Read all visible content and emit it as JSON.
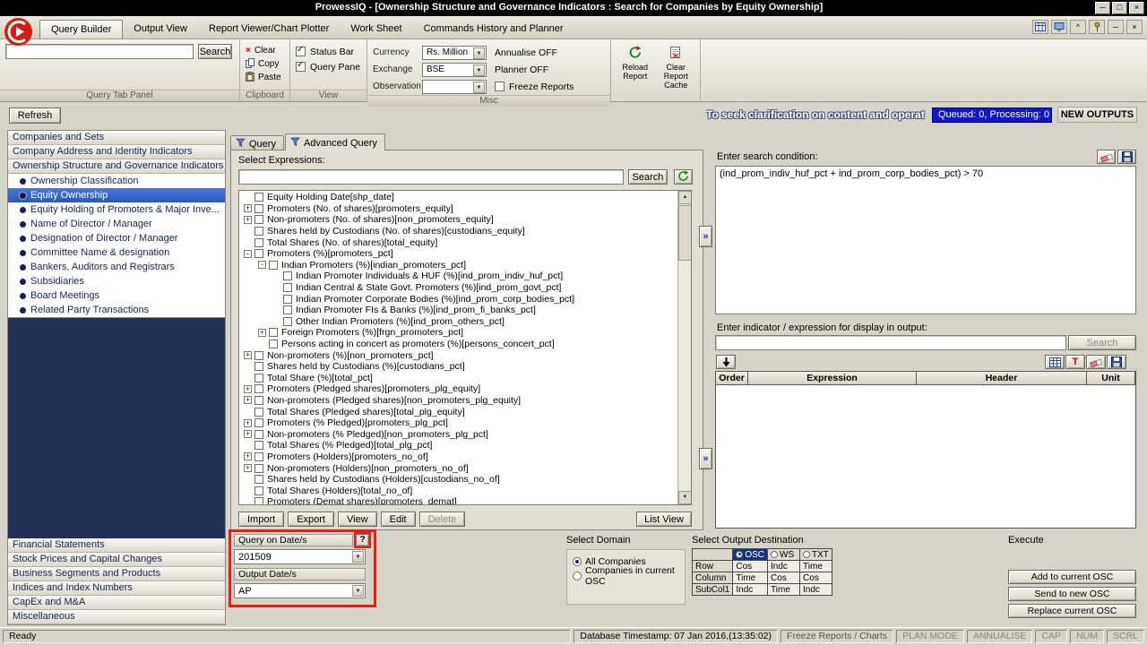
{
  "window": {
    "title": "ProwessIQ  - [Ownership Structure and Governance Indicators : Search for Companies by Equity Ownership]"
  },
  "menu": {
    "tabs": [
      {
        "label": "Query Builder",
        "active": true
      },
      {
        "label": "Output View",
        "active": false
      },
      {
        "label": "Report Viewer/Chart Plotter",
        "active": false
      },
      {
        "label": "Work Sheet",
        "active": false
      },
      {
        "label": "Commands History and Planner",
        "active": false
      }
    ]
  },
  "toolbar": {
    "search": {
      "button": "Search",
      "group_label": "Query Tab Panel"
    },
    "clipboard": {
      "buttons": [
        "Clear",
        "Copy",
        "Paste"
      ],
      "group_label": "Clipboard"
    },
    "view": {
      "checkboxes": [
        {
          "label": "Status Bar",
          "checked": true
        },
        {
          "label": "Query Pane",
          "checked": true
        }
      ],
      "group_label": "View"
    },
    "misc": {
      "fields": [
        {
          "label": "Currency",
          "value": "Rs. Million"
        },
        {
          "label": "Exchange",
          "value": "BSE"
        },
        {
          "label": "Observation",
          "value": ""
        }
      ],
      "toggles": [
        "Annualise OFF",
        "Planner OFF"
      ],
      "freeze_checkbox": {
        "label": "Freeze Reports",
        "checked": false
      },
      "group_label": "Misc"
    },
    "report_buttons": [
      "Reload Report",
      "Clear Report Cache"
    ]
  },
  "info_bar": {
    "refresh_button": "Refresh",
    "marquee": "To seek clarification on content and operat",
    "queue_status": "Queued: 0, Processing: 0",
    "new_outputs": "NEW OUTPUTS"
  },
  "sidebar": {
    "top_sections": [
      "Companies and Sets",
      "Company Address and Identity Indicators",
      "Ownership Structure and Governance Indicators"
    ],
    "items": [
      {
        "label": "Ownership Classification",
        "selected": false
      },
      {
        "label": "Equity Ownership",
        "selected": true
      },
      {
        "label": "Equity Holding of Promoters & Major Inve...",
        "selected": false
      },
      {
        "label": "Name of Director / Manager",
        "selected": false
      },
      {
        "label": "Designation of Director / Manager",
        "selected": false
      },
      {
        "label": "Committee Name & designation",
        "selected": false
      },
      {
        "label": "Bankers, Auditors and Registrars",
        "selected": false
      },
      {
        "label": "Subsidiaries",
        "selected": false
      },
      {
        "label": "Board Meetings",
        "selected": false
      },
      {
        "label": "Related Party Transactions",
        "selected": false
      }
    ],
    "bottom_sections": [
      "Financial Statements",
      "Stock Prices and Capital Changes",
      "Business Segments and Products",
      "Indices and Index Numbers",
      "CapEx and M&A",
      "Miscellaneous"
    ]
  },
  "query_panel": {
    "tabs": [
      {
        "label": "Query",
        "active": false
      },
      {
        "label": "Advanced Query",
        "active": true
      }
    ],
    "select_expressions_label": "Select Expressions:",
    "search_button": "Search",
    "tree": [
      {
        "label": "Equity Holding Date[shp_date]",
        "level": 0,
        "exp": "none"
      },
      {
        "label": "Promoters (No. of shares)[promoters_equity]",
        "level": 0,
        "exp": "plus"
      },
      {
        "label": "Non-promoters (No. of shares)[non_promoters_equity]",
        "level": 0,
        "exp": "plus"
      },
      {
        "label": "Shares held by Custodians (No. of shares)[custodians_equity]",
        "level": 0,
        "exp": "none"
      },
      {
        "label": "Total Shares (No. of shares)[total_equity]",
        "level": 0,
        "exp": "none"
      },
      {
        "label": "Promoters (%)[promoters_pct]",
        "level": 0,
        "exp": "minus"
      },
      {
        "label": "Indian Promoters (%)[indian_promoters_pct]",
        "level": 1,
        "exp": "minus"
      },
      {
        "label": "Indian Promoter Individuals & HUF (%)[ind_prom_indiv_huf_pct]",
        "level": 2,
        "exp": "none"
      },
      {
        "label": "Indian Central & State Govt. Promoters (%)[ind_prom_govt_pct]",
        "level": 2,
        "exp": "none"
      },
      {
        "label": "Indian Promoter Corporate Bodies (%)[ind_prom_corp_bodies_pct]",
        "level": 2,
        "exp": "none"
      },
      {
        "label": "Indian Promoter FIs & Banks (%)[ind_prom_fi_banks_pct]",
        "level": 2,
        "exp": "none"
      },
      {
        "label": "Other Indian Promoters (%)[ind_prom_others_pct]",
        "level": 2,
        "exp": "none"
      },
      {
        "label": "Foreign Promoters (%)[frgn_promoters_pct]",
        "level": 1,
        "exp": "plus"
      },
      {
        "label": "Persons acting in concert as promoters (%)[persons_concert_pct]",
        "level": 1,
        "exp": "none"
      },
      {
        "label": "Non-promoters (%)[non_promoters_pct]",
        "level": 0,
        "exp": "plus"
      },
      {
        "label": "Shares held by Custodians (%)[custodians_pct]",
        "level": 0,
        "exp": "none"
      },
      {
        "label": "Total Share (%)[total_pct]",
        "level": 0,
        "exp": "none"
      },
      {
        "label": "Promoters (Pledged shares)[promoters_plg_equity]",
        "level": 0,
        "exp": "plus"
      },
      {
        "label": "Non-promoters (Pledged shares)[non_promoters_plg_equity]",
        "level": 0,
        "exp": "plus"
      },
      {
        "label": "Total Shares (Pledged shares)[total_plg_equity]",
        "level": 0,
        "exp": "none"
      },
      {
        "label": "Promoters (% Pledged)[promoters_plg_pct]",
        "level": 0,
        "exp": "plus"
      },
      {
        "label": "Non-promoters (% Pledged)[non_promoters_plg_pct]",
        "level": 0,
        "exp": "plus"
      },
      {
        "label": "Total Shares (% Pledged)[total_plg_pct]",
        "level": 0,
        "exp": "none"
      },
      {
        "label": "Promoters (Holders)[promoters_no_of]",
        "level": 0,
        "exp": "plus"
      },
      {
        "label": "Non-promoters (Holders)[non_promoters_no_of]",
        "level": 0,
        "exp": "plus"
      },
      {
        "label": "Shares held by Custodians (Holders)[custodians_no_of]",
        "level": 0,
        "exp": "none"
      },
      {
        "label": "Total Shares (Holders)[total_no_of]",
        "level": 0,
        "exp": "none"
      },
      {
        "label": "Promoters (Demat shares)[promoters_demat]",
        "level": 0,
        "exp": "none"
      }
    ],
    "buttons": [
      {
        "label": "Import",
        "disabled": false
      },
      {
        "label": "Export",
        "disabled": false
      },
      {
        "label": "View",
        "disabled": false
      },
      {
        "label": "Edit",
        "disabled": false
      },
      {
        "label": "Delete",
        "disabled": true
      }
    ],
    "list_view_button": "List View"
  },
  "date_panel": {
    "query_on_date_label": "Query on Date/s",
    "help_button": "?",
    "query_date_value": "201509",
    "output_date_label": "Output Date/s",
    "output_date_value": "AP"
  },
  "domain_panel": {
    "title": "Select Domain",
    "options": [
      {
        "label": "All Companies",
        "selected": true
      },
      {
        "label": "Companies in current OSC",
        "selected": false
      }
    ]
  },
  "output_destination": {
    "title": "Select Output Destination",
    "columns": [
      "OSC",
      "WS",
      "TXT"
    ],
    "selected_column": "OSC",
    "rows": [
      {
        "label": "Row",
        "values": [
          "Cos",
          "Indc",
          "Time"
        ]
      },
      {
        "label": "Column",
        "values": [
          "Time",
          "Cos",
          "Cos"
        ]
      },
      {
        "label": "SubCol1",
        "values": [
          "Indc",
          "Time",
          "Indc"
        ]
      }
    ]
  },
  "execute_panel": {
    "title": "Execute",
    "buttons": [
      "Add to current OSC",
      "Send to new OSC",
      "Replace current OSC"
    ]
  },
  "condition_panel": {
    "label": "Enter search condition:",
    "value": "(ind_prom_indiv_huf_pct + ind_prom_corp_bodies_pct) > 70",
    "indicator_label": "Enter indicator / expression for display in output:",
    "indicator_value": "",
    "search_button": "Search",
    "table_headers": [
      "Order",
      "Expression",
      "Header",
      "Unit"
    ]
  },
  "status_bar": {
    "ready": "Ready",
    "db_timestamp": "Database Timestamp: 07 Jan 2016,(13:35:02)",
    "freeze": "Freeze Reports / Charts",
    "flags": [
      "PLAN MODE",
      "ANNUALISE",
      "CAP",
      "NUM",
      "SCRL"
    ]
  }
}
